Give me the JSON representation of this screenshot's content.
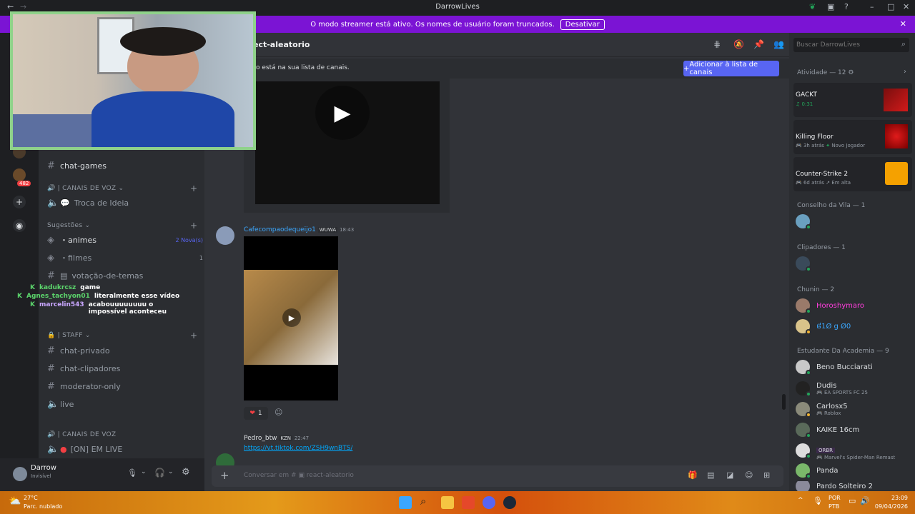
{
  "window": {
    "title": "DarrowLives"
  },
  "banner": {
    "text": "O modo streamer está ativo. Os nomes de usuário foram truncados.",
    "button": "Desativar"
  },
  "guilds": {
    "mention_badge": "482"
  },
  "sidebar": {
    "items": [
      {
        "label": "chat-games",
        "type": "text"
      },
      {
        "label": "| CANAIS DE VOZ",
        "type": "category"
      },
      {
        "label": "Troca de Ideia",
        "type": "voice"
      },
      {
        "label": "Sugestões",
        "type": "category"
      },
      {
        "label": "・animes",
        "type": "forum",
        "badge": "2 Nova(s)"
      },
      {
        "label": "・filmes",
        "type": "forum",
        "badge": "1"
      },
      {
        "label": "votação-de-temas",
        "type": "text"
      },
      {
        "label": "| STAFF",
        "type": "category"
      },
      {
        "label": "chat-privado",
        "type": "text"
      },
      {
        "label": "chat-clipadores",
        "type": "text"
      },
      {
        "label": "moderator-only",
        "type": "text"
      },
      {
        "label": "live",
        "type": "voice"
      },
      {
        "label": "| CANAIS DE VOZ",
        "type": "category"
      },
      {
        "label": "[ON] EM LIVE",
        "type": "voice"
      }
    ]
  },
  "overlay_chat": [
    {
      "user": "kadukrcsz",
      "text": "game",
      "color": "#5bd36b"
    },
    {
      "user": "Agnes_tachyon01",
      "text": "literalmente esse vídeo",
      "color": "#5bd36b"
    },
    {
      "user": "marcelin543",
      "text": "acabouuuuuuuu o impossível aconteceu",
      "color": "#c9a7ff"
    }
  ],
  "user": {
    "name": "Darrow",
    "status": "Invisível"
  },
  "main": {
    "channel": "react-aleatorio",
    "channel_visible": "ect-aleatorio",
    "notice": "o está na sua lista de canais.",
    "add_button": "Adicionar à lista de canais",
    "messages": [
      {
        "author": "Cafecompaodequeijo1",
        "tag": "WUWA",
        "time": "18:43",
        "reaction_count": "1"
      },
      {
        "author": "Pedro_btw",
        "tag": "KZN",
        "time": "22:47",
        "link": "https://vt.tiktok.com/ZSH9wnBTS/"
      }
    ],
    "input_placeholder": "Conversar em #",
    "input_channel": "react-aleatorio"
  },
  "search": {
    "placeholder": "Buscar DarrowLives"
  },
  "members": {
    "activity_header": "Atividade — 12",
    "activities": [
      {
        "game": "GACKT",
        "sub": "0:31"
      },
      {
        "game": "Killing Floor",
        "sub": "3h atrás",
        "tag": "Novo Jogador"
      },
      {
        "game": "Counter-Strike 2",
        "sub": "6d atrás",
        "tag": "Em alta"
      }
    ],
    "groups": [
      {
        "title": "Conselho da Vila — 1",
        "members": [
          {
            "name": "",
            "sub": ""
          }
        ]
      },
      {
        "title": "Clipadores — 1",
        "members": [
          {
            "name": "",
            "sub": ""
          }
        ]
      },
      {
        "title": "Chunin — 2",
        "members": [
          {
            "name": "Horoshymaro",
            "sub": "",
            "color": "#ff3ddc"
          },
          {
            "name": "៨1Ø g Ø0",
            "sub": "",
            "color": "#3ba8ff"
          }
        ]
      },
      {
        "title": "Estudante Da Academia — 9",
        "members": [
          {
            "name": "Beno Bucciarati",
            "sub": ""
          },
          {
            "name": "Dudis",
            "sub": "EA SPORTS FC 25"
          },
          {
            "name": "Carlosx5",
            "sub": "Roblox"
          },
          {
            "name": "KAIKE 16cm",
            "sub": ""
          },
          {
            "name": "ORBR",
            "sub": "Marvel's Spider-Man Remast"
          },
          {
            "name": "Panda",
            "sub": ""
          },
          {
            "name": "Pardo Solteiro 2",
            "sub": ""
          }
        ]
      }
    ]
  },
  "taskbar": {
    "temp": "27°C",
    "weather": "Parc. nublado",
    "lang1": "POR",
    "lang2": "PTB",
    "time": "23:09",
    "date": "09/04/2026"
  },
  "colors": {
    "banner": "#7b14d4",
    "accent": "#5865f2",
    "link": "#00a8fc",
    "author1": "#3ba8ff"
  }
}
